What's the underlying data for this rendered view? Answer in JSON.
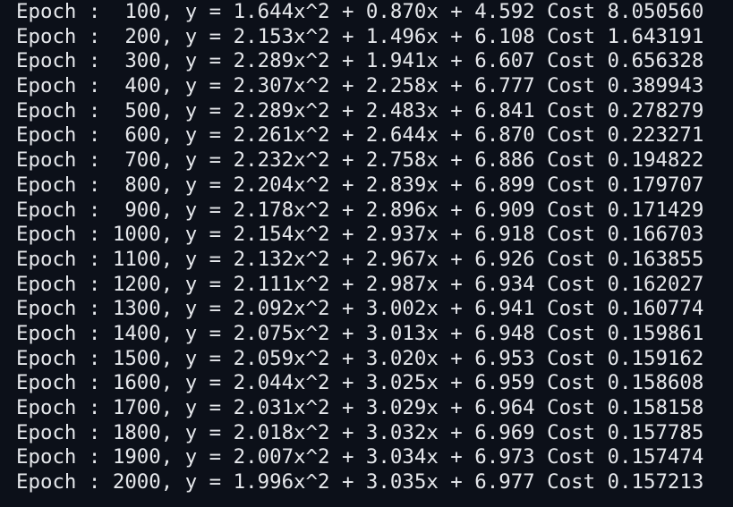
{
  "terminal": {
    "lines": [
      "Epoch :  100, y = 1.644x^2 + 0.870x + 4.592 Cost 8.050560",
      "Epoch :  200, y = 2.153x^2 + 1.496x + 6.108 Cost 1.643191",
      "Epoch :  300, y = 2.289x^2 + 1.941x + 6.607 Cost 0.656328",
      "Epoch :  400, y = 2.307x^2 + 2.258x + 6.777 Cost 0.389943",
      "Epoch :  500, y = 2.289x^2 + 2.483x + 6.841 Cost 0.278279",
      "Epoch :  600, y = 2.261x^2 + 2.644x + 6.870 Cost 0.223271",
      "Epoch :  700, y = 2.232x^2 + 2.758x + 6.886 Cost 0.194822",
      "Epoch :  800, y = 2.204x^2 + 2.839x + 6.899 Cost 0.179707",
      "Epoch :  900, y = 2.178x^2 + 2.896x + 6.909 Cost 0.171429",
      "Epoch : 1000, y = 2.154x^2 + 2.937x + 6.918 Cost 0.166703",
      "Epoch : 1100, y = 2.132x^2 + 2.967x + 6.926 Cost 0.163855",
      "Epoch : 1200, y = 2.111x^2 + 2.987x + 6.934 Cost 0.162027",
      "Epoch : 1300, y = 2.092x^2 + 3.002x + 6.941 Cost 0.160774",
      "Epoch : 1400, y = 2.075x^2 + 3.013x + 6.948 Cost 0.159861",
      "Epoch : 1500, y = 2.059x^2 + 3.020x + 6.953 Cost 0.159162",
      "Epoch : 1600, y = 2.044x^2 + 3.025x + 6.959 Cost 0.158608",
      "Epoch : 1700, y = 2.031x^2 + 3.029x + 6.964 Cost 0.158158",
      "Epoch : 1800, y = 2.018x^2 + 3.032x + 6.969 Cost 0.157785",
      "Epoch : 1900, y = 2.007x^2 + 3.034x + 6.973 Cost 0.157474",
      "Epoch : 2000, y = 1.996x^2 + 3.035x + 6.977 Cost 0.157213"
    ]
  },
  "colors": {
    "background": "#0c1019",
    "text": "#e6e8ec"
  }
}
